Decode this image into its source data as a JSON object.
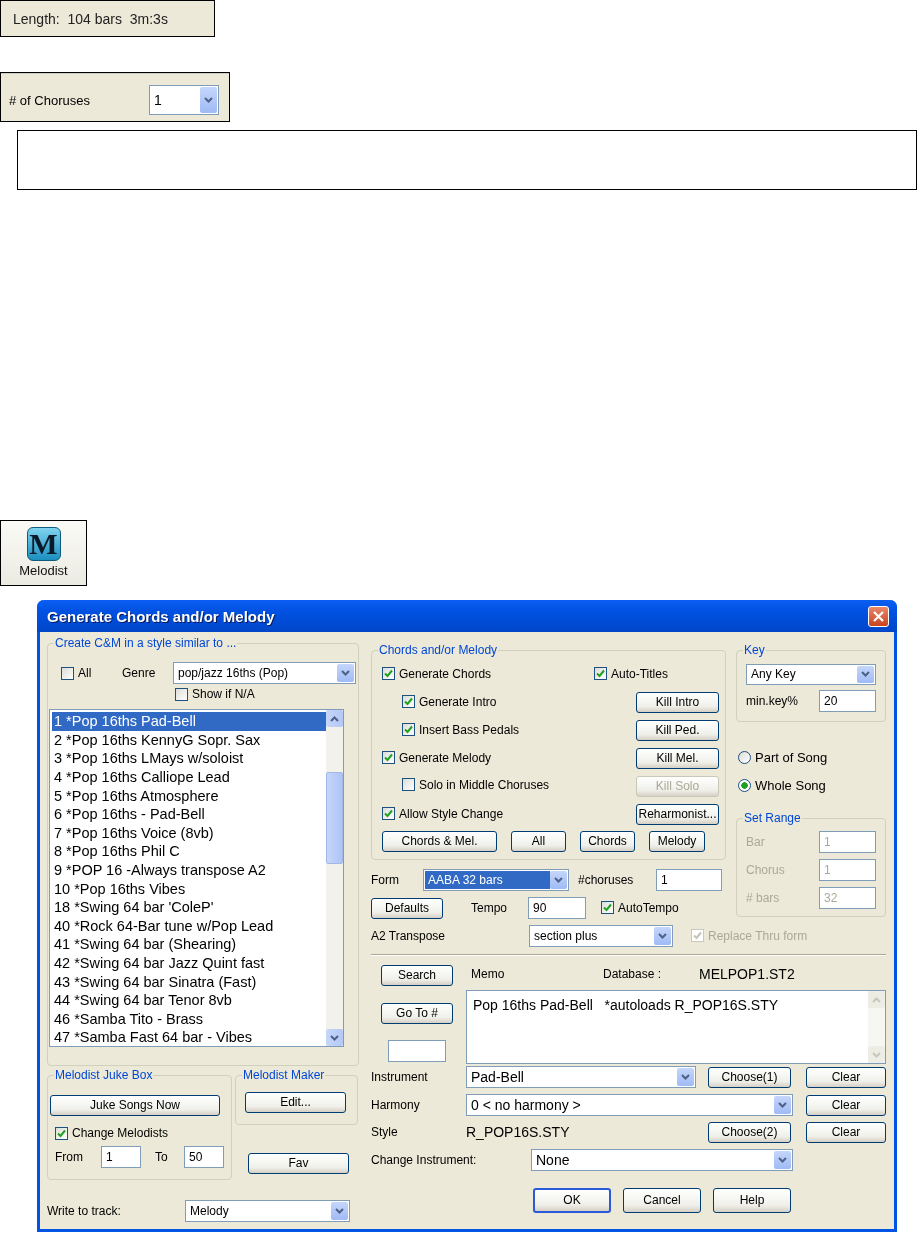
{
  "length_panel": {
    "text": "Length:  104 bars  3m:3s"
  },
  "choruses_panel": {
    "label": "# of Choruses",
    "value": "1"
  },
  "toolbar_button": {
    "logo": "M",
    "label": "Melodist"
  },
  "dialog": {
    "title": "Generate Chords and/or Melody",
    "style_group": {
      "title": "Create C&M in a style similar to ...",
      "all": {
        "label": "All",
        "checked": false
      },
      "genre_label": "Genre",
      "genre": "pop/jazz 16ths (Pop)",
      "show_na": {
        "label": "Show if N/A",
        "checked": false
      },
      "items": [
        {
          "label": "1 *Pop 16ths Pad-Bell",
          "selected": true
        },
        {
          "label": "2 *Pop 16ths KennyG Sopr. Sax",
          "selected": false
        },
        {
          "label": "3 *Pop 16ths LMays w/soloist",
          "selected": false
        },
        {
          "label": "4 *Pop 16ths Calliope Lead",
          "selected": false
        },
        {
          "label": "5 *Pop 16ths Atmosphere",
          "selected": false
        },
        {
          "label": "6 *Pop 16ths - Pad-Bell",
          "selected": false
        },
        {
          "label": "7 *Pop 16ths Voice (8vb)",
          "selected": false
        },
        {
          "label": "8 *Pop 16ths Phil C",
          "selected": false
        },
        {
          "label": "9 *POP 16 -Always transpose A2",
          "selected": false
        },
        {
          "label": "10 *Pop 16ths Vibes",
          "selected": false
        },
        {
          "label": "18 *Swing 64 bar 'ColeP'",
          "selected": false
        },
        {
          "label": "40 *Rock 64-Bar tune w/Pop Lead",
          "selected": false
        },
        {
          "label": "41 *Swing 64 bar (Shearing)",
          "selected": false
        },
        {
          "label": "42 *Swing 64 bar Jazz Quint fast",
          "selected": false
        },
        {
          "label": "43 *Swing 64 bar Sinatra (Fast)",
          "selected": false
        },
        {
          "label": "44 *Swing 64 bar Tenor 8vb",
          "selected": false
        },
        {
          "label": "46 *Samba Tito - Brass",
          "selected": false
        },
        {
          "label": "47 *Samba Fast 64 bar - Vibes",
          "selected": false
        }
      ]
    },
    "juke_box": {
      "title": "Melodist Juke Box",
      "button": "Juke Songs Now",
      "change": {
        "label": "Change Melodists",
        "checked": true
      },
      "from_label": "From",
      "from": "1",
      "to_label": "To",
      "to": "50"
    },
    "maker": {
      "title": "Melodist Maker",
      "button": "Edit..."
    },
    "fav_button": "Fav",
    "write_track": {
      "label": "Write to track:",
      "value": "Melody"
    },
    "chords_group": {
      "title": "Chords and/or Melody",
      "options": [
        {
          "label": "Generate Chords",
          "checked": true,
          "side": {
            "kind": "check",
            "label": "Auto-Titles",
            "checked": true
          },
          "children": [
            {
              "label": "Generate Intro",
              "checked": true,
              "side": {
                "kind": "button",
                "label": "Kill Intro",
                "disabled": false
              }
            },
            {
              "label": "Insert Bass Pedals",
              "checked": true,
              "side": {
                "kind": "button",
                "label": "Kill Ped.",
                "disabled": false
              }
            }
          ]
        },
        {
          "label": "Generate Melody",
          "checked": true,
          "side": {
            "kind": "button",
            "label": "Kill Mel.",
            "disabled": false
          },
          "children": [
            {
              "label": "Solo in Middle Choruses",
              "checked": false,
              "side": {
                "kind": "button",
                "label": "Kill Solo",
                "disabled": true
              }
            }
          ]
        },
        {
          "label": "Allow Style Change",
          "checked": true,
          "side": {
            "kind": "button",
            "label": "Reharmonist...",
            "disabled": false
          }
        }
      ],
      "buttons": [
        "Chords & Mel.",
        "All",
        "Chords",
        "Melody"
      ]
    },
    "form": {
      "label": "Form",
      "value": "AABA 32 bars",
      "focused": true
    },
    "choruses": {
      "label": "#choruses",
      "value": "1"
    },
    "defaults_button": "Defaults",
    "tempo": {
      "label": "Tempo",
      "value": "90"
    },
    "auto_tempo": {
      "label": "AutoTempo",
      "checked": true
    },
    "a2_transpose": {
      "label": "A2 Transpose",
      "value": "section plus"
    },
    "replace_thru": {
      "label": "Replace Thru form",
      "checked": true,
      "disabled": true
    },
    "key_group": {
      "title": "Key",
      "value": "Any Key",
      "min_label": "min.key%",
      "min": "20"
    },
    "scope": [
      {
        "label": "Part of Song",
        "selected": false
      },
      {
        "label": "Whole Song",
        "selected": true
      }
    ],
    "set_range": {
      "title": "Set Range",
      "disabled": true,
      "fields": [
        {
          "label": "Bar",
          "value": "1"
        },
        {
          "label": "Chorus",
          "value": "1"
        },
        {
          "label": "# bars",
          "value": "32"
        }
      ]
    },
    "search_button": "Search",
    "memo_label": "Memo",
    "database_label": "Database :",
    "database": "MELPOP1.ST2",
    "goto_button": "Go To #",
    "memo": "Pop 16ths Pad-Bell   *autoloads R_POP16S.STY",
    "instrument": {
      "label": "Instrument",
      "value": "Pad-Bell",
      "choose": "Choose(1)",
      "clear": "Clear"
    },
    "harmony": {
      "label": "Harmony",
      "value": "0 < no harmony >",
      "clear": "Clear"
    },
    "style": {
      "label": "Style",
      "value": "R_POP16S.STY",
      "choose": "Choose(2)",
      "clear": "Clear"
    },
    "change_instrument": {
      "label": "Change Instrument:",
      "value": "None"
    },
    "footer_buttons": [
      "OK",
      "Cancel",
      "Help"
    ]
  }
}
